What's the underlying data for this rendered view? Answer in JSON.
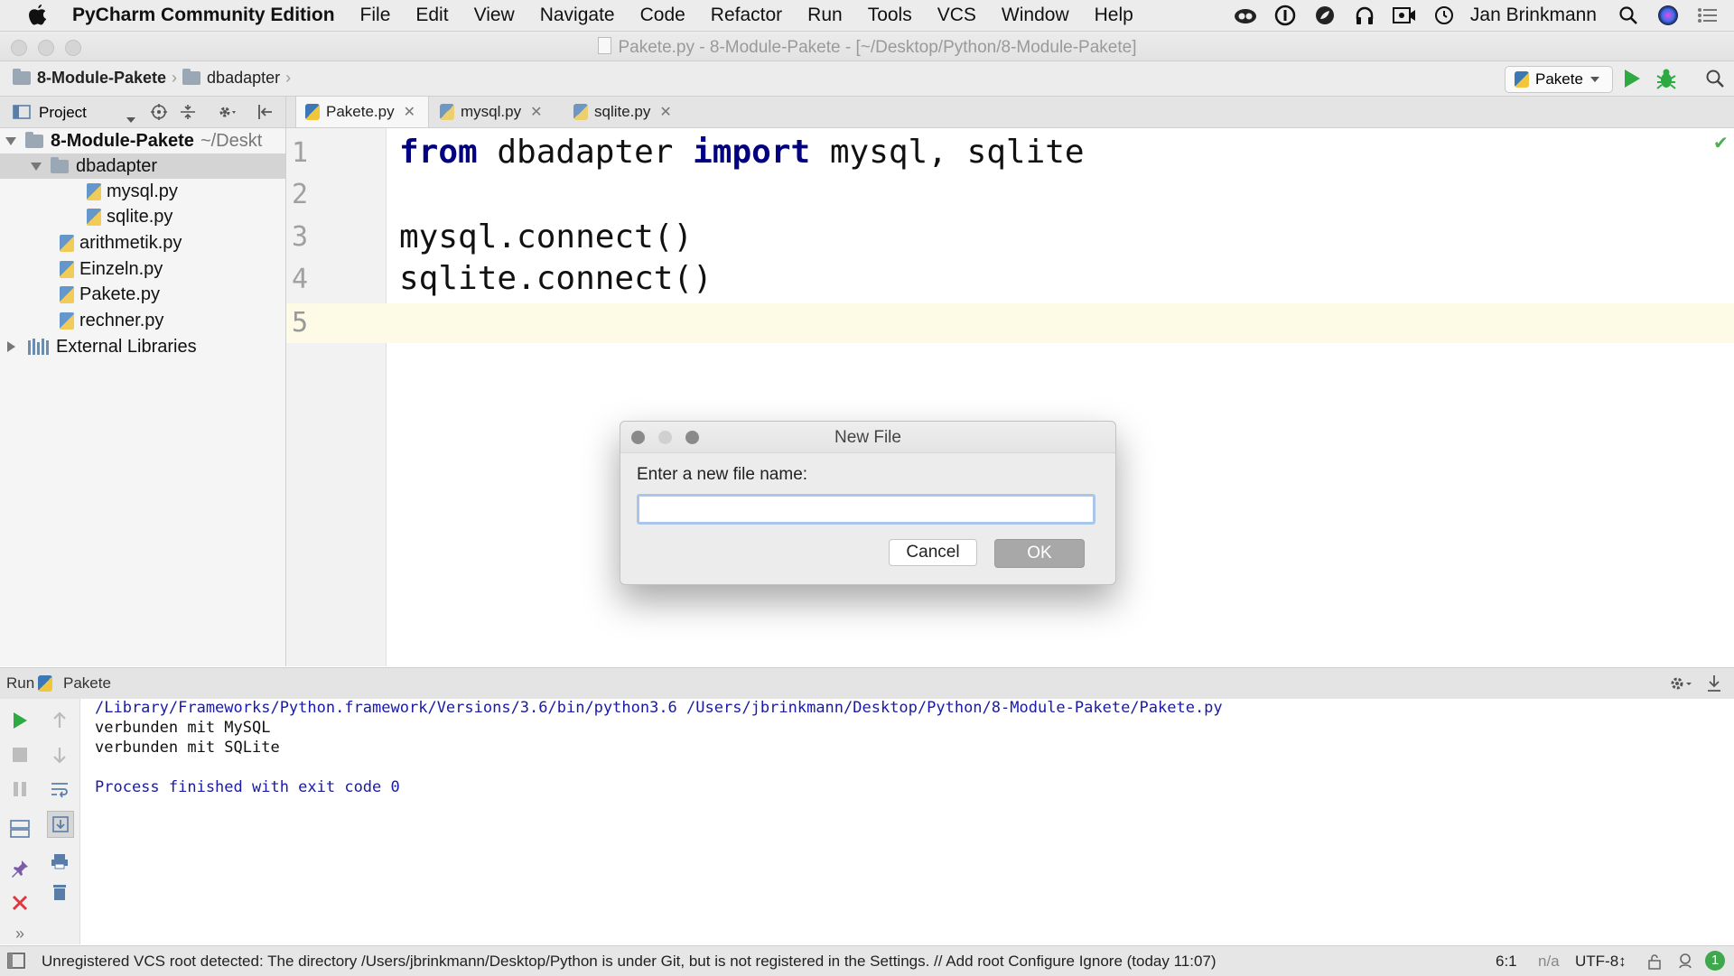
{
  "menubar": {
    "app_name": "PyCharm Community Edition",
    "items": [
      "File",
      "Edit",
      "View",
      "Navigate",
      "Code",
      "Refactor",
      "Run",
      "Tools",
      "VCS",
      "Window",
      "Help"
    ],
    "user": "Jan Brinkmann"
  },
  "window": {
    "title": "Pakete.py - 8-Module-Pakete - [~/Desktop/Python/8-Module-Pakete]"
  },
  "navbar": {
    "breadcrumbs": [
      "8-Module-Pakete",
      "dbadapter"
    ],
    "run_config": "Pakete"
  },
  "project_panel": {
    "title": "Project",
    "tree": [
      {
        "label": "8-Module-Pakete",
        "suffix": "~/Deskt"
      },
      {
        "label": "dbadapter"
      },
      {
        "label": "mysql.py"
      },
      {
        "label": "sqlite.py"
      },
      {
        "label": "arithmetik.py"
      },
      {
        "label": "Einzeln.py"
      },
      {
        "label": "Pakete.py"
      },
      {
        "label": "rechner.py"
      },
      {
        "label": "External Libraries"
      }
    ]
  },
  "editor": {
    "tabs": [
      {
        "label": "Pakete.py",
        "active": true
      },
      {
        "label": "mysql.py"
      },
      {
        "label": "sqlite.py"
      }
    ],
    "line_numbers": [
      "1",
      "2",
      "3",
      "4",
      "5"
    ],
    "line1": {
      "kw_from": "from",
      "module": " dbadapter ",
      "kw_import": "import",
      "names": " mysql, sqlite"
    },
    "line3": "mysql.connect()",
    "line4": "sqlite.connect()"
  },
  "dialog": {
    "title": "New File",
    "prompt": "Enter a new file name:",
    "input_value": "",
    "cancel_label": "Cancel",
    "ok_label": "OK"
  },
  "run_panel": {
    "label": "Run",
    "config": "Pakete",
    "console": {
      "command": "/Library/Frameworks/Python.framework/Versions/3.6/bin/python3.6 /Users/jbrinkmann/Desktop/Python/8-Module-Pakete/Pakete.py",
      "out1": "verbunden mit MySQL",
      "out2": "verbunden mit SQLite",
      "exit": "Process finished with exit code 0"
    }
  },
  "statusbar": {
    "message": "Unregistered VCS root detected: The directory /Users/jbrinkmann/Desktop/Python is under Git, but is not registered in the Settings. // Add root  Configure  Ignore (today 11:07)",
    "position": "6:1",
    "na": "n/a",
    "encoding": "UTF-8↕",
    "notifications": "1"
  },
  "colors": {
    "keyword": "#000080",
    "current_line": "#fdfbe5",
    "run_green": "#2eaa43",
    "stop_red": "#e0383e"
  }
}
